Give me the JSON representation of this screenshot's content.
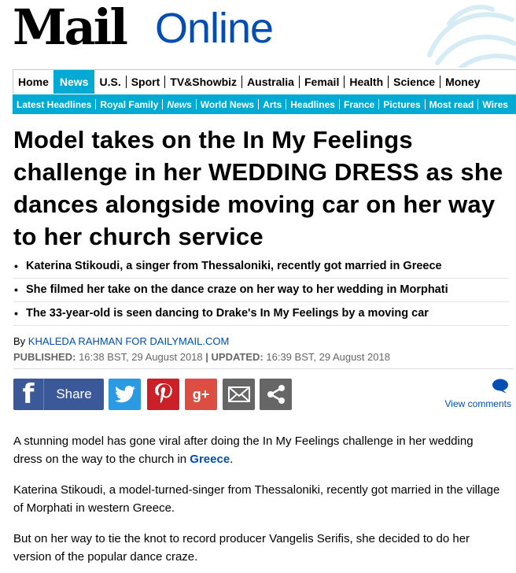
{
  "brand": {
    "mail": "Mail",
    "online": "Online"
  },
  "nav_primary": [
    "Home",
    "News",
    "U.S.",
    "Sport",
    "TV&Showbiz",
    "Australia",
    "Femail",
    "Health",
    "Science",
    "Money"
  ],
  "nav_primary_active": "News",
  "nav_secondary": [
    "Latest Headlines",
    "Royal Family",
    "News",
    "World News",
    "Arts",
    "Headlines",
    "France",
    "Pictures",
    "Most read",
    "Wires"
  ],
  "headline": "Model takes on the In My Feelings challenge in her WEDDING DRESS as she dances alongside moving car on her way to her church service",
  "bullets": [
    "Katerina Stikoudi, a singer from Thessaloniki, recently got married in Greece",
    "She filmed her take on the dance craze on her way to her wedding in Morphati",
    "The 33-year-old is seen dancing to Drake's In My Feelings by a moving car"
  ],
  "byline": {
    "prefix": "By",
    "author": "KHALEDA RAHMAN FOR DAILYMAIL.COM"
  },
  "dates": {
    "published_label": "PUBLISHED:",
    "published": "16:38 BST, 29 August 2018",
    "separator": "|",
    "updated_label": "UPDATED:",
    "updated": "16:39 BST, 29 August 2018"
  },
  "share": {
    "facebook_label": "Share",
    "gplus_label": "g+"
  },
  "comments_label": "View comments",
  "body": {
    "p1_before": "A stunning model has gone viral after doing the In My Feelings challenge in her wedding dress on the way to the church in ",
    "p1_link": "Greece",
    "p1_after": ".",
    "p2": "Katerina Stikoudi, a model-turned-singer from Thessaloniki, recently got married in the village of Morphati in western Greece.",
    "p3": "But on her way to tie the knot to record producer Vangelis Serifis, she decided to do her version of the popular dance craze."
  },
  "icons": [
    "facebook-icon",
    "twitter-icon",
    "pinterest-icon",
    "google-plus-icon",
    "email-icon",
    "share-icon",
    "comment-bubble-icon"
  ],
  "colors": {
    "brand_blue": "#004db3",
    "nav_blue": "#00aad2",
    "facebook": "#3b5998",
    "twitter": "#2c9ae3",
    "pinterest": "#cb2027",
    "gplus": "#dc4e41"
  }
}
